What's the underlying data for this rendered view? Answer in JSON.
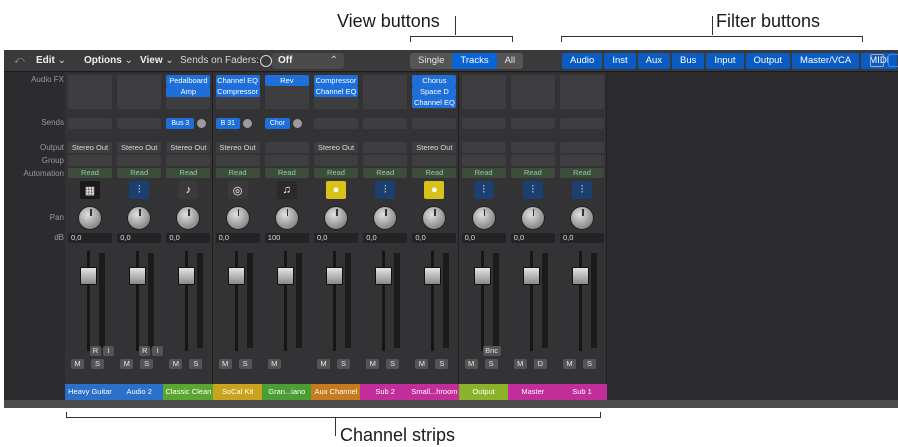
{
  "callouts": {
    "view_buttons": "View buttons",
    "filter_buttons": "Filter buttons",
    "channel_strips": "Channel strips"
  },
  "toolbar": {
    "back": "⤺",
    "edit": "Edit",
    "options": "Options",
    "view": "View",
    "sends_on_faders": "Sends on Faders:",
    "sends_value": "Off",
    "view_modes": [
      "Single",
      "Tracks",
      "All"
    ],
    "active_view": "Tracks",
    "filters": [
      "Audio",
      "Inst",
      "Aux",
      "Bus",
      "Input",
      "Output",
      "Master/VCA",
      "MIDI"
    ]
  },
  "row_labels": {
    "audio_fx": "Audio FX",
    "sends": "Sends",
    "output": "Output",
    "group": "Group",
    "automation": "Automation",
    "pan": "Pan",
    "db": "dB"
  },
  "strips": [
    {
      "name": "Heavy Guitar",
      "fx": [],
      "send": "",
      "output": "Stereo Out",
      "automation": "Read",
      "db": "0,0",
      "icon": "amp-icon",
      "ri": true,
      "m": "M",
      "s": "S",
      "color": "#2a6fc9"
    },
    {
      "name": "Audio 2",
      "fx": [],
      "send": "",
      "output": "Stereo Out",
      "automation": "Read",
      "db": "0,0",
      "icon": "waveform-icon",
      "ri": true,
      "m": "M",
      "s": "S",
      "color": "#2a6fc9"
    },
    {
      "name": "Classic Clean",
      "fx": [
        "Pedalboard",
        "Amp"
      ],
      "send": "Bus 3",
      "output": "Stereo Out",
      "automation": "Read",
      "db": "0,0",
      "icon": "guitar-icon",
      "ri": false,
      "m": "M",
      "s": "S",
      "color": "#5ba62e"
    },
    {
      "name": "SoCal Kit",
      "fx": [
        "Channel EQ",
        "Compressor"
      ],
      "send": "B 31",
      "output": "Stereo Out",
      "automation": "Read",
      "db": "0,0",
      "icon": "drums-icon",
      "ri": false,
      "m": "M",
      "s": "S",
      "color": "#c9a21e"
    },
    {
      "name": "Gran...iano",
      "fx": [
        "Rev"
      ],
      "send": "Chor",
      "output": "",
      "automation": "Read",
      "db": "100",
      "icon": "piano-icon",
      "ri": false,
      "m": "M",
      "s": "",
      "color": "#4b9e33"
    },
    {
      "name": "Aux Channel",
      "fx": [
        "Compressor",
        "Channel EQ"
      ],
      "send": "",
      "output": "Stereo Out",
      "automation": "Read",
      "db": "0,0",
      "icon": "aux-icon",
      "ri": false,
      "m": "M",
      "s": "S",
      "color": "#c77a1e"
    },
    {
      "name": "Sub 2",
      "fx": [],
      "send": "",
      "output": "",
      "automation": "Read",
      "db": "0,0",
      "icon": "waveform-icon",
      "ri": false,
      "m": "M",
      "s": "S",
      "color": "#c22d9a"
    },
    {
      "name": "Small...hroom",
      "fx": [
        "Chorus",
        "Space D",
        "Channel EQ"
      ],
      "send": "",
      "output": "Stereo Out",
      "automation": "Read",
      "db": "0,0",
      "icon": "aux-icon",
      "ri": false,
      "m": "M",
      "s": "S",
      "color": "#c22d9a"
    },
    {
      "name": "Output",
      "fx": [],
      "send": "",
      "output": "",
      "automation": "Read",
      "db": "0,0",
      "icon": "waveform-icon",
      "ri": false,
      "bnc": "Bnc",
      "m": "M",
      "s": "S",
      "color": "#8bb32a"
    },
    {
      "name": "Master",
      "fx": [],
      "send": "",
      "output": "",
      "automation": "Read",
      "db": "0,0",
      "icon": "waveform-icon",
      "ri": false,
      "m": "M",
      "s": "D",
      "color": "#c22d9a"
    },
    {
      "name": "Sub 1",
      "fx": [],
      "send": "",
      "output": "",
      "automation": "Read",
      "db": "0,0",
      "icon": "waveform-icon",
      "ri": false,
      "m": "M",
      "s": "S",
      "color": "#c22d9a"
    }
  ]
}
